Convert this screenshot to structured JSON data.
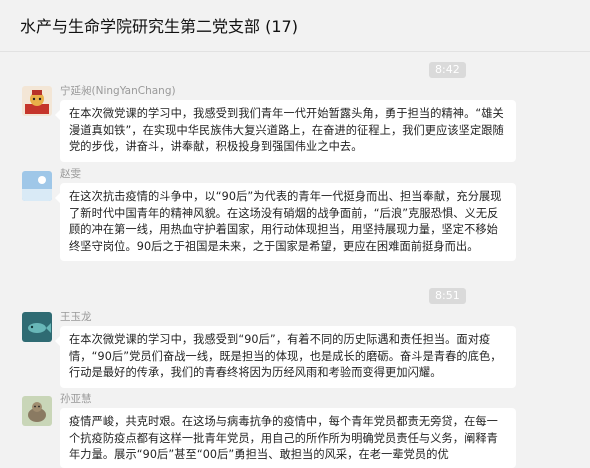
{
  "chat": {
    "title": "水产与生命学院研究生第二党支部 (17)"
  },
  "timestamps": [
    "8:42",
    "8:51"
  ],
  "messages": [
    {
      "sender": "宁延昶(NingYanChang)",
      "avatar": "avatar-red-cartoon",
      "text": "在本次微党课的学习中，我感受到我们青年一代开始暂露头角，勇于担当的精神。“雄关漫道真如铁”，在实现中华民族伟大复兴道路上，在奋进的征程上，我们更应该坚定跟随党的步伐，讲奋斗，讲奉献，积极投身到强国伟业之中去。"
    },
    {
      "sender": "赵雯",
      "avatar": "avatar-sky",
      "text": "在这次抗击疫情的斗争中，以“90后”为代表的青年一代挺身而出、担当奉献，充分展现了新时代中国青年的精神风貌。在这场没有硝烟的战争面前，“后浪”克服恐惧、义无反顾的冲在第一线，用热血守护着国家，用行动体现担当，用坚持展现力量，坚定不移始终坚守岗位。90后之于祖国是未来，之于国家是希望，更应在困难面前挺身而出。"
    },
    {
      "sender": "王玉龙",
      "avatar": "avatar-teal-fish",
      "text": "在本次微党课的学习中，我感受到“90后”，有着不同的历史际遇和责任担当。面对疫情，“90后”党员们奋战一线，既是担当的体现，也是成长的磨砺。奋斗是青春的底色，行动是最好的传承，我们的青春终将因为历经风雨和考验而变得更加闪耀。"
    },
    {
      "sender": "孙亚慧",
      "avatar": "avatar-animal",
      "text": "疫情严峻，共克时艰。在这场与病毒抗争的疫情中，每个青年党员都责无旁贷，在每一个抗疫防疫点都有这样一批青年党员，用自己的所作所为明确党员责任与义务，阐释青年力量。展示“90后”甚至“00后”勇担当、敢担当的风采，在老一辈党员的优"
    }
  ]
}
